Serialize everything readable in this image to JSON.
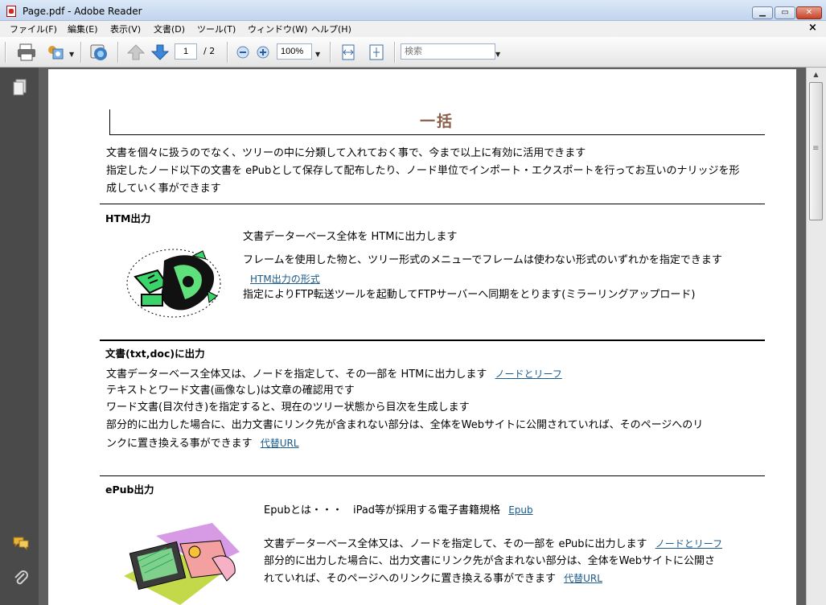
{
  "window": {
    "title": "Page.pdf - Adobe Reader"
  },
  "menu": [
    "ファイル(F)",
    "編集(E)",
    "表示(V)",
    "文書(D)",
    "ツール(T)",
    "ウィンドウ(W)",
    "ヘルプ(H)"
  ],
  "toolbar": {
    "page_current": "1",
    "page_total": "/ 2",
    "zoom": "100%",
    "search_placeholder": "検索"
  },
  "document": {
    "title": "一括",
    "intro": [
      "文書を個々に扱うのでなく、ツリーの中に分類して入れておく事で、今まで以上に有効に活用できます",
      "指定したノード以下の文書を ePubとして保存して配布したり、ノード単位でインポート・エクスポートを行ってお互いのナリッジを形",
      "成していく事ができます"
    ],
    "htm": {
      "heading": "HTM出力",
      "line1": "文書データーベース全体を HTMに出力します",
      "line2": "フレームを使用した物と、ツリー形式のメニューでフレームは使わない形式のいずれかを指定できます",
      "link": "HTM出力の形式",
      "line3": "指定によりFTP転送ツールを起動してFTPサーバーへ同期をとります(ミラーリングアップロード)"
    },
    "txt": {
      "heading": "文書(txt,doc)に出力",
      "line1": "文書データーベース全体又は、ノードを指定して、その一部を HTMに出力します",
      "link1": "ノードとリーフ",
      "line2": "テキストとワード文書(画像なし)は文章の確認用です",
      "line3": "ワード文書(目次付き)を指定すると、現在のツリー状態から目次を生成します",
      "line4": "部分的に出力した場合に、出力文書にリンク先が含まれない部分は、全体をWebサイトに公開されていれば、そのページへのリ",
      "line5": "ンクに置き換える事ができます",
      "link2": "代替URL"
    },
    "epub": {
      "heading": "ePub出力",
      "line1": "Epubとは・・・　iPad等が採用する電子書籍規格",
      "link1": "Epub",
      "line2": "文書データーベース全体又は、ノードを指定して、その一部を ePubに出力します",
      "link2": "ノードとリーフ",
      "line3": "部分的に出力した場合に、出力文書にリンク先が含まれない部分は、全体をWebサイトに公開さ",
      "line4": "れていれば、そのページへのリンクに置き換える事ができます",
      "link3": "代替URL"
    }
  }
}
